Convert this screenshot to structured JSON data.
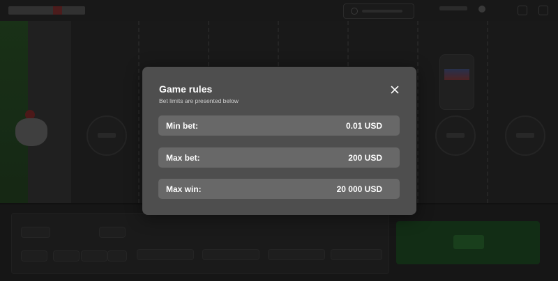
{
  "modal": {
    "title": "Game rules",
    "subtitle": "Bet limits are presented below",
    "close_icon": "close-icon",
    "rows": [
      {
        "label": "Min bet:",
        "value": "0.01 USD"
      },
      {
        "label": "Max bet:",
        "value": "200 USD"
      },
      {
        "label": "Max win:",
        "value": "20 000 USD"
      }
    ]
  },
  "colors": {
    "modal_bg": "#4e4e4e",
    "row_bg": "#686868",
    "play_button": "#163519"
  }
}
